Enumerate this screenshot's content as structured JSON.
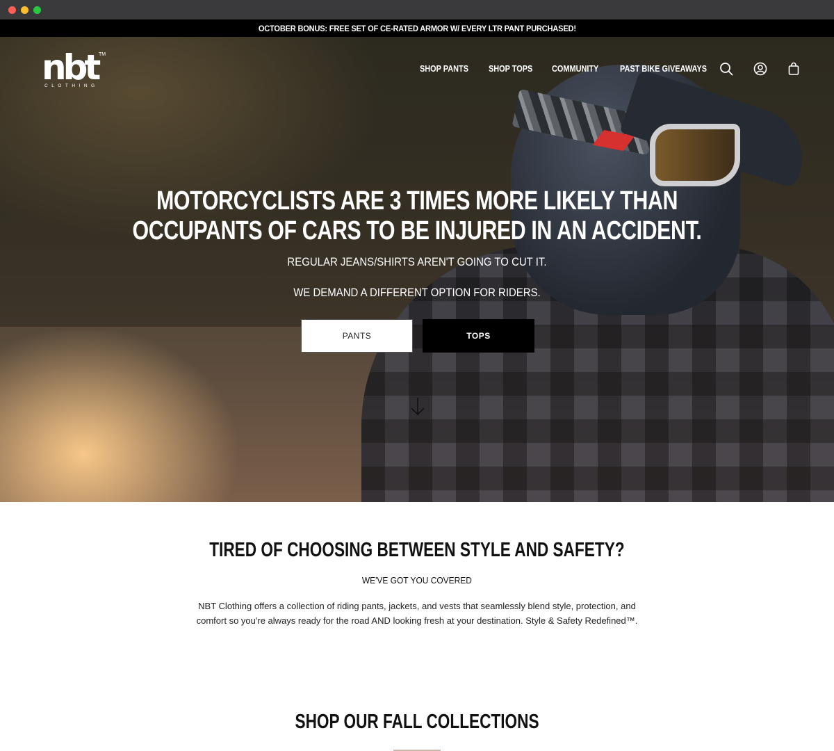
{
  "announcement": "OCTOBER BONUS: FREE SET OF CE-RATED ARMOR W/ EVERY LTR PANT PURCHASED!",
  "header": {
    "logo_text": "nbt",
    "logo_tm": "TM",
    "logo_sub": "CLOTHING",
    "nav": [
      "SHOP PANTS",
      "SHOP TOPS",
      "COMMUNITY",
      "PAST BIKE GIVEAWAYS"
    ],
    "icons": [
      "search-icon",
      "account-icon",
      "cart-icon"
    ]
  },
  "hero": {
    "headline": "MOTORCYCLISTS ARE 3 TIMES MORE LIKELY THAN OCCUPANTS OF CARS TO BE INJURED IN AN ACCIDENT.",
    "subline_1": "REGULAR JEANS/SHIRTS AREN'T GOING TO CUT IT.",
    "subline_2": "WE DEMAND A DIFFERENT OPTION FOR RIDERS.",
    "button_pants": "PANTS",
    "button_tops": "TOPS"
  },
  "intro": {
    "title": "TIRED OF CHOOSING BETWEEN STYLE AND SAFETY?",
    "subtitle": "WE'VE GOT YOU COVERED",
    "paragraph": "NBT Clothing offers a collection of riding pants, jackets, and vests that seamlessly blend style, protection, and comfort so you're always ready for the road AND looking fresh at your destination. Style & Safety Redefined™."
  },
  "collections": {
    "title": "SHOP OUR FALL COLLECTIONS"
  },
  "colors": {
    "announcement_bg": "#000000",
    "accent_rule": "#c9b8a9"
  }
}
